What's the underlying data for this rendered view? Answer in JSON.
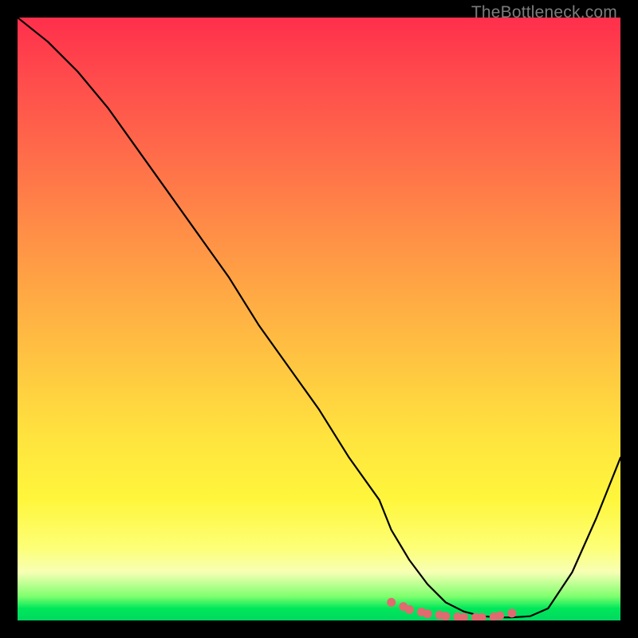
{
  "watermark": "TheBottleneck.com",
  "chart_data": {
    "type": "line",
    "title": "",
    "xlabel": "",
    "ylabel": "",
    "xlim": [
      0,
      100
    ],
    "ylim": [
      0,
      100
    ],
    "series": [
      {
        "name": "curve",
        "x": [
          0,
          5,
          10,
          15,
          20,
          25,
          30,
          35,
          40,
          45,
          50,
          55,
          60,
          62,
          65,
          68,
          71,
          74,
          77,
          80,
          82,
          85,
          88,
          92,
          96,
          100
        ],
        "y": [
          100,
          96,
          91,
          85,
          78,
          71,
          64,
          57,
          49,
          42,
          35,
          27,
          20,
          15,
          10,
          6,
          3,
          1.5,
          0.7,
          0.5,
          0.5,
          0.7,
          2,
          8,
          17,
          27
        ]
      }
    ],
    "markers": {
      "name": "highlight-dots",
      "color": "#e06a6f",
      "x": [
        62,
        64,
        65,
        67,
        68,
        70,
        71,
        73,
        74,
        76,
        77,
        79,
        80,
        82
      ],
      "y": [
        3.0,
        2.3,
        1.8,
        1.4,
        1.1,
        0.9,
        0.7,
        0.6,
        0.5,
        0.5,
        0.5,
        0.6,
        0.8,
        1.2
      ]
    }
  }
}
